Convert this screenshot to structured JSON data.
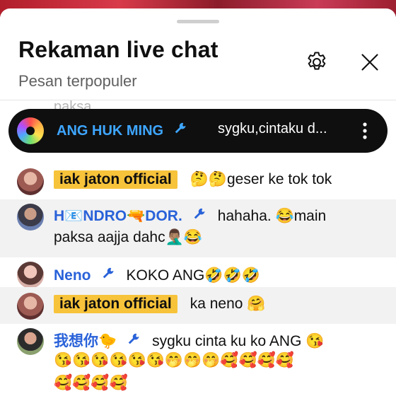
{
  "header": {
    "title": "Rekaman live chat",
    "subtitle": "Pesan terpopuler"
  },
  "faded_previous": "paksa",
  "pinned": {
    "author": "ANG HUK MING",
    "message": "sygku,cintaku d..."
  },
  "messages": [
    {
      "author": "iak jaton official",
      "highlighted": true,
      "text": "🤔🤔geser ke tok tok"
    },
    {
      "author": "H📧NDRO🔫DOR.",
      "moderator": true,
      "text": "hahaha. 😂main",
      "text2": "paksa aajja dahc🤦🏽‍♂️😂"
    },
    {
      "author": "Neno",
      "moderator": true,
      "text": "KOKO ANG🤣🤣🤣"
    },
    {
      "author": "iak jaton official",
      "highlighted": true,
      "text": "ka neno 🤗"
    },
    {
      "author": "我想你🐤",
      "moderator": true,
      "text": "sygku cinta ku ko ANG 😘",
      "text2": "😘😘😘😘😘😘🤭🤭🤭🥰🥰🥰🥰",
      "text3": "🥰🥰🥰🥰"
    }
  ],
  "colors": {
    "author_blue": "#2962d9",
    "pinned_author": "#3ea6ff",
    "highlight_badge": "#f7c33a",
    "pinned_bg": "#0f0f0f"
  }
}
